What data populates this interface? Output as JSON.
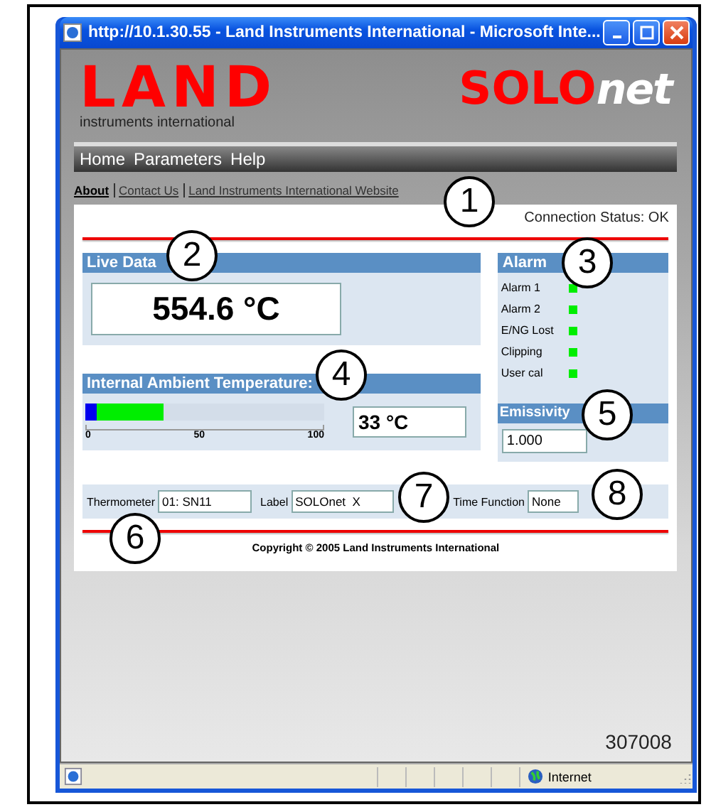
{
  "window": {
    "title": "http://10.1.30.55 - Land Instruments International - Microsoft Inte..."
  },
  "logo": {
    "brand": "LAND",
    "tagline": "instruments international",
    "product": "SOLO",
    "product_suffix": "net"
  },
  "menu": [
    "Home",
    "Parameters",
    "Help"
  ],
  "links": [
    {
      "label": "About",
      "selected": true
    },
    {
      "label": "Contact Us",
      "selected": false
    },
    {
      "label": "Land Instruments International Website",
      "selected": false
    }
  ],
  "connection_status": "Connection Status: OK",
  "live_data": {
    "title": "Live Data",
    "value": "554.6 °C"
  },
  "ambient": {
    "title": "Internal Ambient Temperature:",
    "level": 0.33,
    "ticks": [
      "0",
      "50",
      "100"
    ],
    "value": "33 °C"
  },
  "alarm": {
    "title": "Alarm",
    "items": [
      {
        "label": "Alarm 1",
        "color": "#00ee00"
      },
      {
        "label": "Alarm 2",
        "color": "#00ee00"
      },
      {
        "label": "E/NG Lost",
        "color": "#00ee00"
      },
      {
        "label": "Clipping",
        "color": "#00ee00"
      },
      {
        "label": "User cal",
        "color": "#00ee00"
      }
    ]
  },
  "emissivity": {
    "title": "Emissivity",
    "value": "1.000"
  },
  "fields": [
    {
      "label": "Thermometer",
      "value": "01: SN11"
    },
    {
      "label": "Label",
      "value": "SOLOnet  X"
    },
    {
      "label": "Time Function",
      "value": "None"
    }
  ],
  "copyright": "Copyright © 2005 Land Instruments International",
  "figure_number": "307008",
  "status_bar": {
    "zone": "Internet"
  },
  "callouts": [
    {
      "text": "1"
    },
    {
      "text": "2"
    },
    {
      "text": "3"
    },
    {
      "text": "4"
    },
    {
      "text": "5"
    },
    {
      "text": "6"
    },
    {
      "text": "7"
    },
    {
      "text": "8"
    }
  ]
}
